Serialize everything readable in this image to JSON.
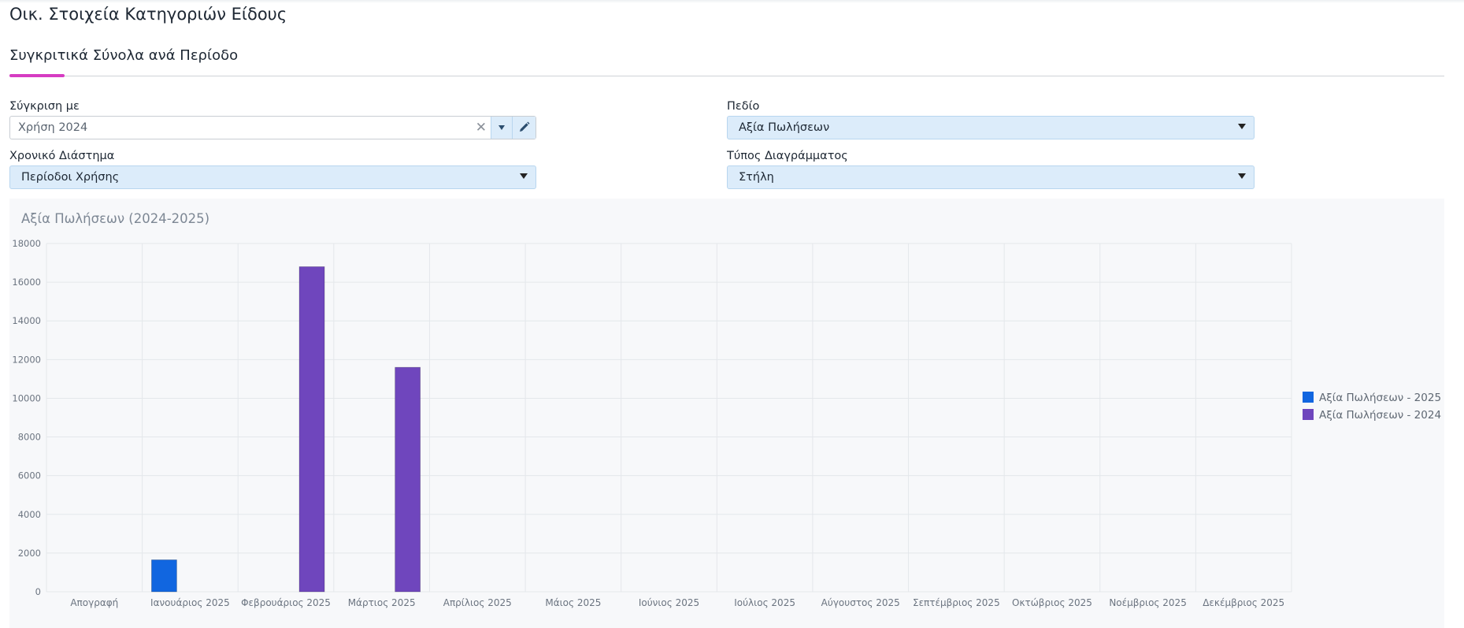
{
  "header": {
    "title": "Οικ. Στοιχεία Κατηγοριών Είδους"
  },
  "tabs": [
    {
      "label": "Συγκριτικά Σύνολα ανά Περίοδο",
      "active": true
    }
  ],
  "form": {
    "compare": {
      "label": "Σύγκριση με",
      "value": "Χρήση 2024"
    },
    "field": {
      "label": "Πεδίο",
      "value": "Αξία Πωλήσεων"
    },
    "interval": {
      "label": "Χρονικό Διάστημα",
      "value": "Περίοδοι Χρήσης"
    },
    "chart_type": {
      "label": "Τύπος Διαγράμματος",
      "value": "Στήλη"
    }
  },
  "colors": {
    "accent_tab": "#d63cc2",
    "series_2025": "#1166e0",
    "series_2024": "#6f46bd"
  },
  "chart_data": {
    "type": "bar",
    "title": "Αξία Πωλήσεων (2024-2025)",
    "categories": [
      "Απογραφή",
      "Ιανουάριος 2025",
      "Φεβρουάριος 2025",
      "Μάρτιος 2025",
      "Απρίλιος 2025",
      "Μάιος 2025",
      "Ιούνιος 2025",
      "Ιούλιος 2025",
      "Αύγουστος 2025",
      "Σεπτέμβριος 2025",
      "Οκτώβριος 2025",
      "Νοέμβριος 2025",
      "Δεκέμβριος 2025"
    ],
    "series": [
      {
        "name": "Αξία Πωλήσεων - 2025",
        "color": "#1166e0",
        "values": [
          0,
          1650,
          0,
          0,
          0,
          0,
          0,
          0,
          0,
          0,
          0,
          0,
          0
        ]
      },
      {
        "name": "Αξία Πωλήσεων - 2024",
        "color": "#6f46bd",
        "values": [
          0,
          0,
          16800,
          11600,
          0,
          0,
          0,
          0,
          0,
          0,
          0,
          0,
          0
        ]
      }
    ],
    "ylim": [
      0,
      18000
    ],
    "yticks": [
      "0",
      "2000",
      "4000",
      "6000",
      "8000",
      "10000",
      "12000",
      "14000",
      "16000",
      "18000"
    ],
    "grid": true,
    "legend": "right"
  }
}
